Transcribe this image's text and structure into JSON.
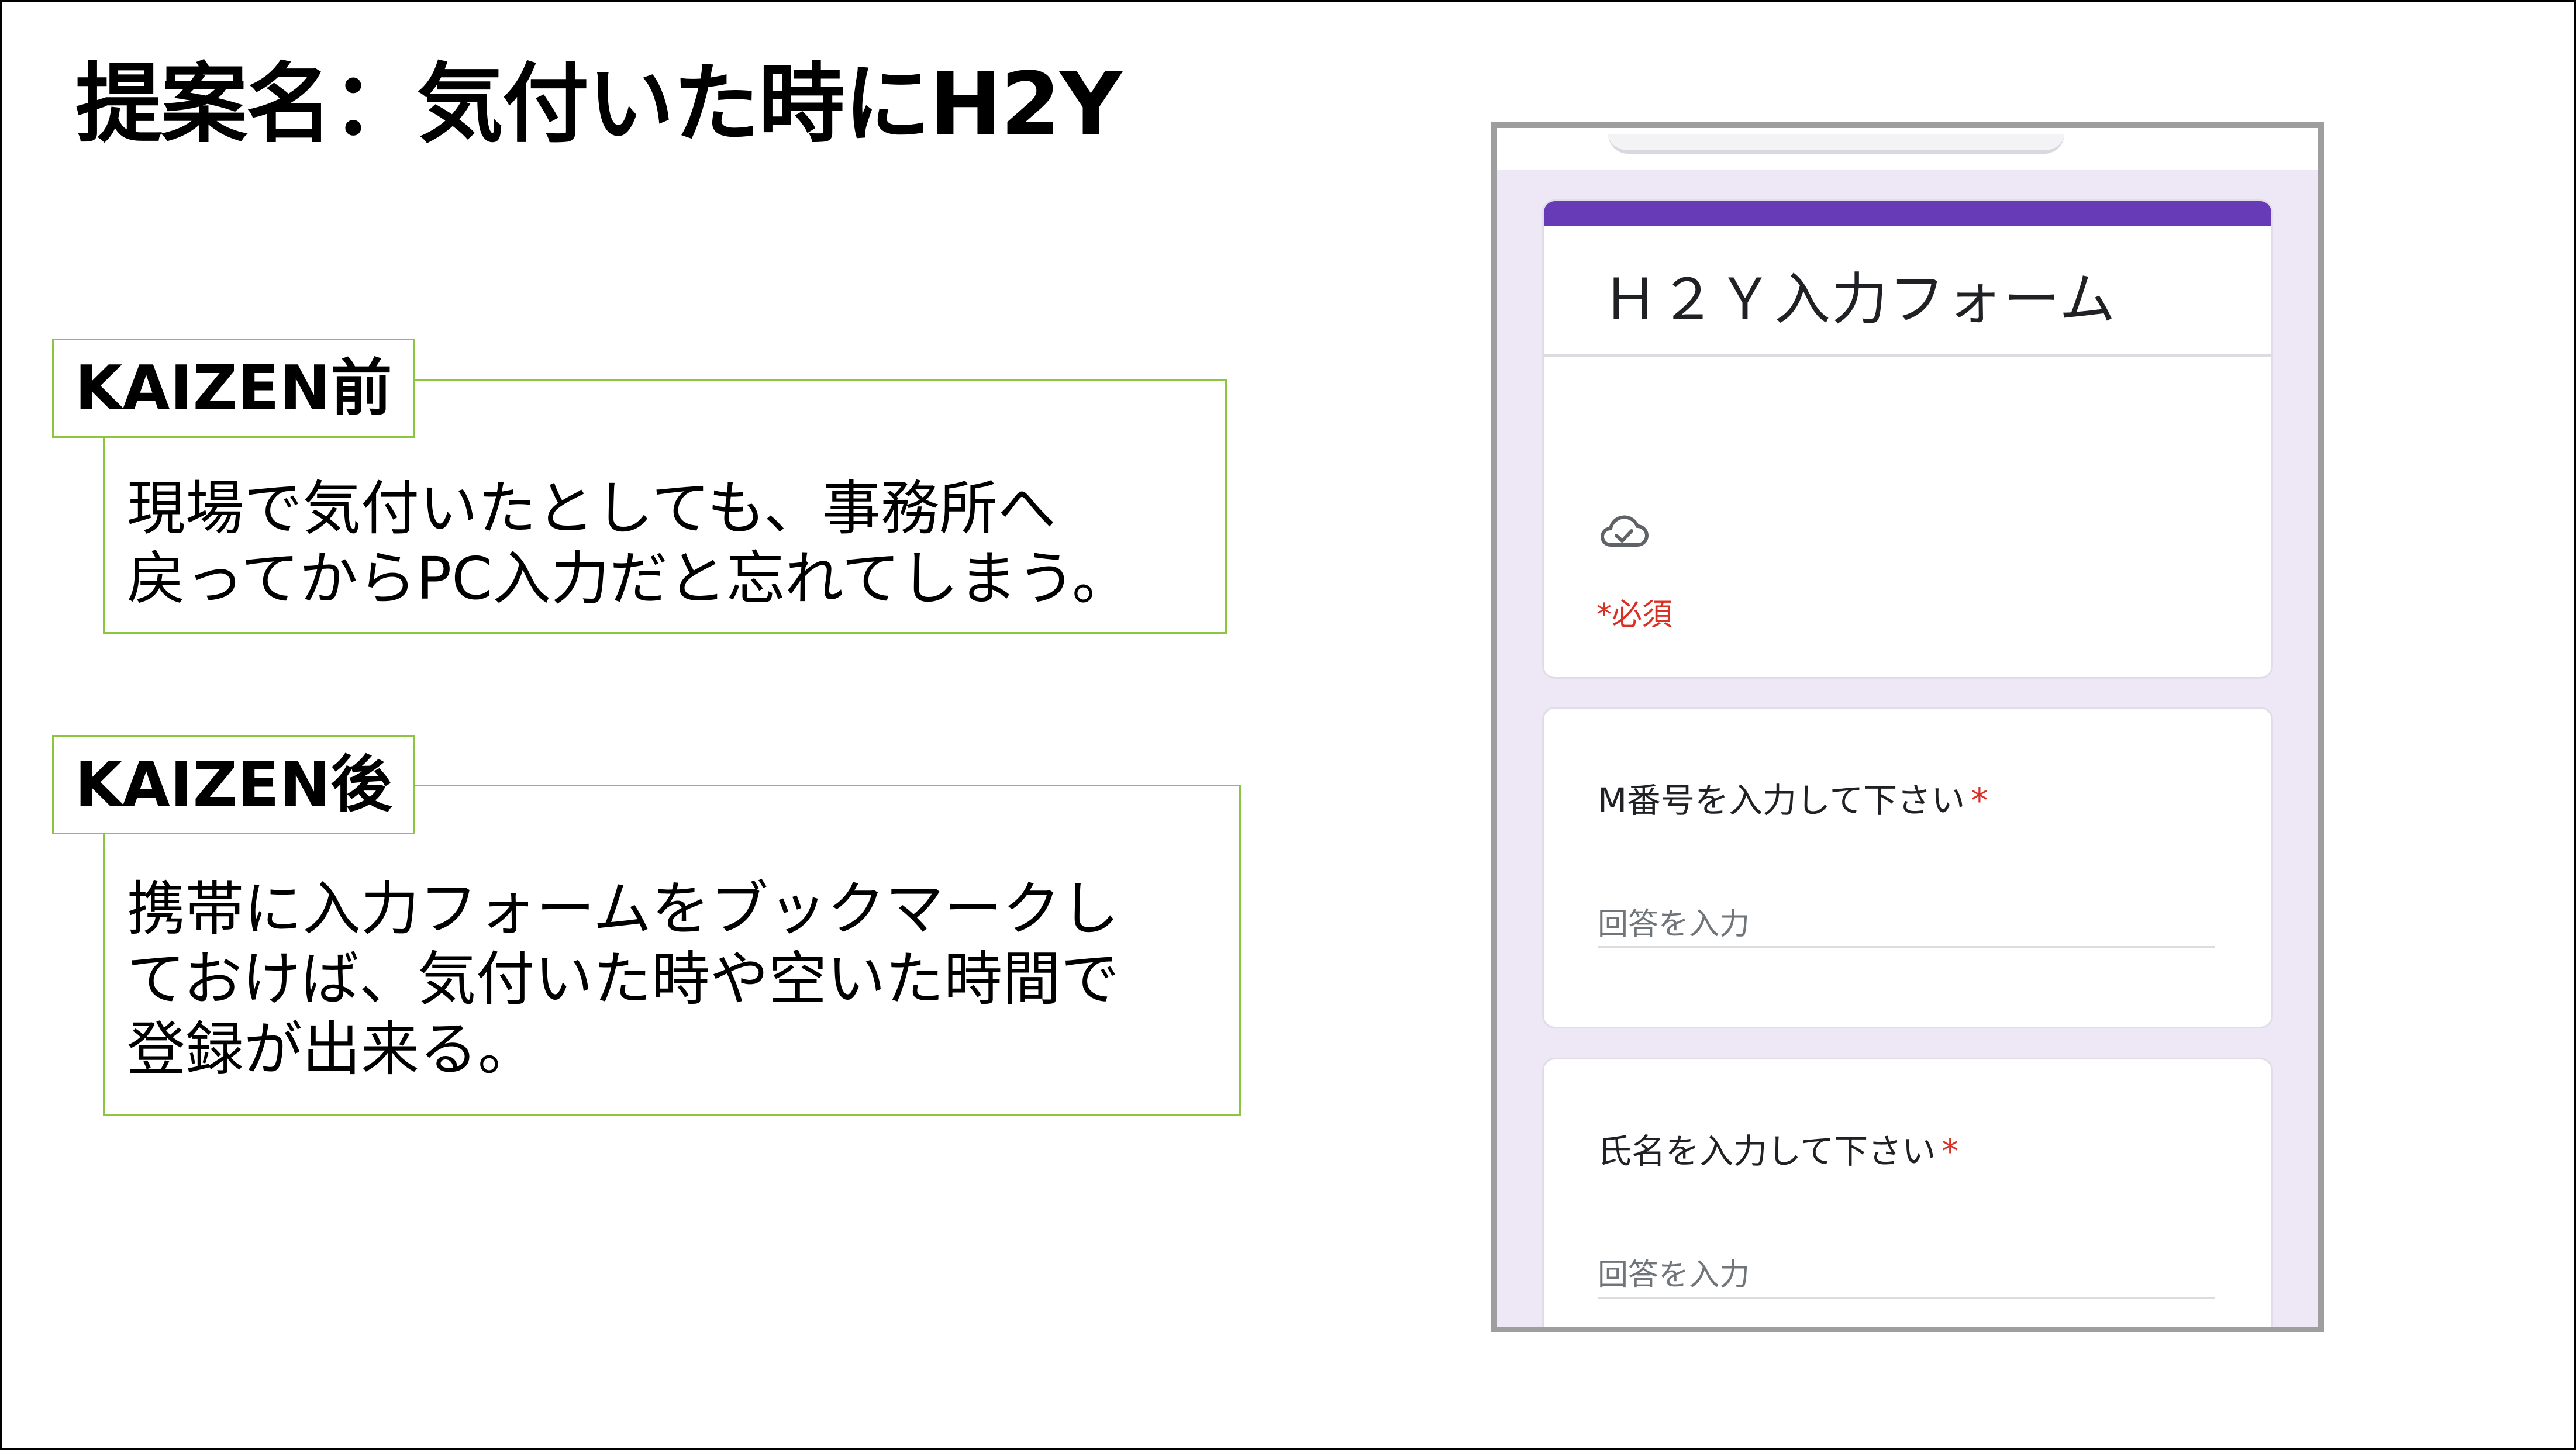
{
  "title": "提案名：気付いた時にH2Y",
  "before": {
    "label": "KAIZEN前",
    "lines": [
      "現場で気付いたとしても、事務所へ",
      "戻ってからPC入力だと忘れてしまう。"
    ]
  },
  "after": {
    "label": "KAIZEN後",
    "lines": [
      "携帯に入力フォームをブックマークし",
      "ておけば、気付いた時や空いた時間で",
      "登録が出来る。"
    ]
  },
  "form": {
    "title": "Ｈ２Ｙ入力フォーム",
    "cloud_icon": "cloud-check-icon",
    "required_note": "*必須",
    "questions": [
      {
        "label": "M番号を入力して下さい",
        "required_mark": "*",
        "placeholder": "回答を入力"
      },
      {
        "label": "氏名を入力して下さい",
        "required_mark": "*",
        "placeholder": "回答を入力"
      }
    ],
    "colors": {
      "accent": "#673ab7",
      "required": "#d93025",
      "background": "#ede7f6",
      "label_border": "#8cc63f"
    }
  }
}
